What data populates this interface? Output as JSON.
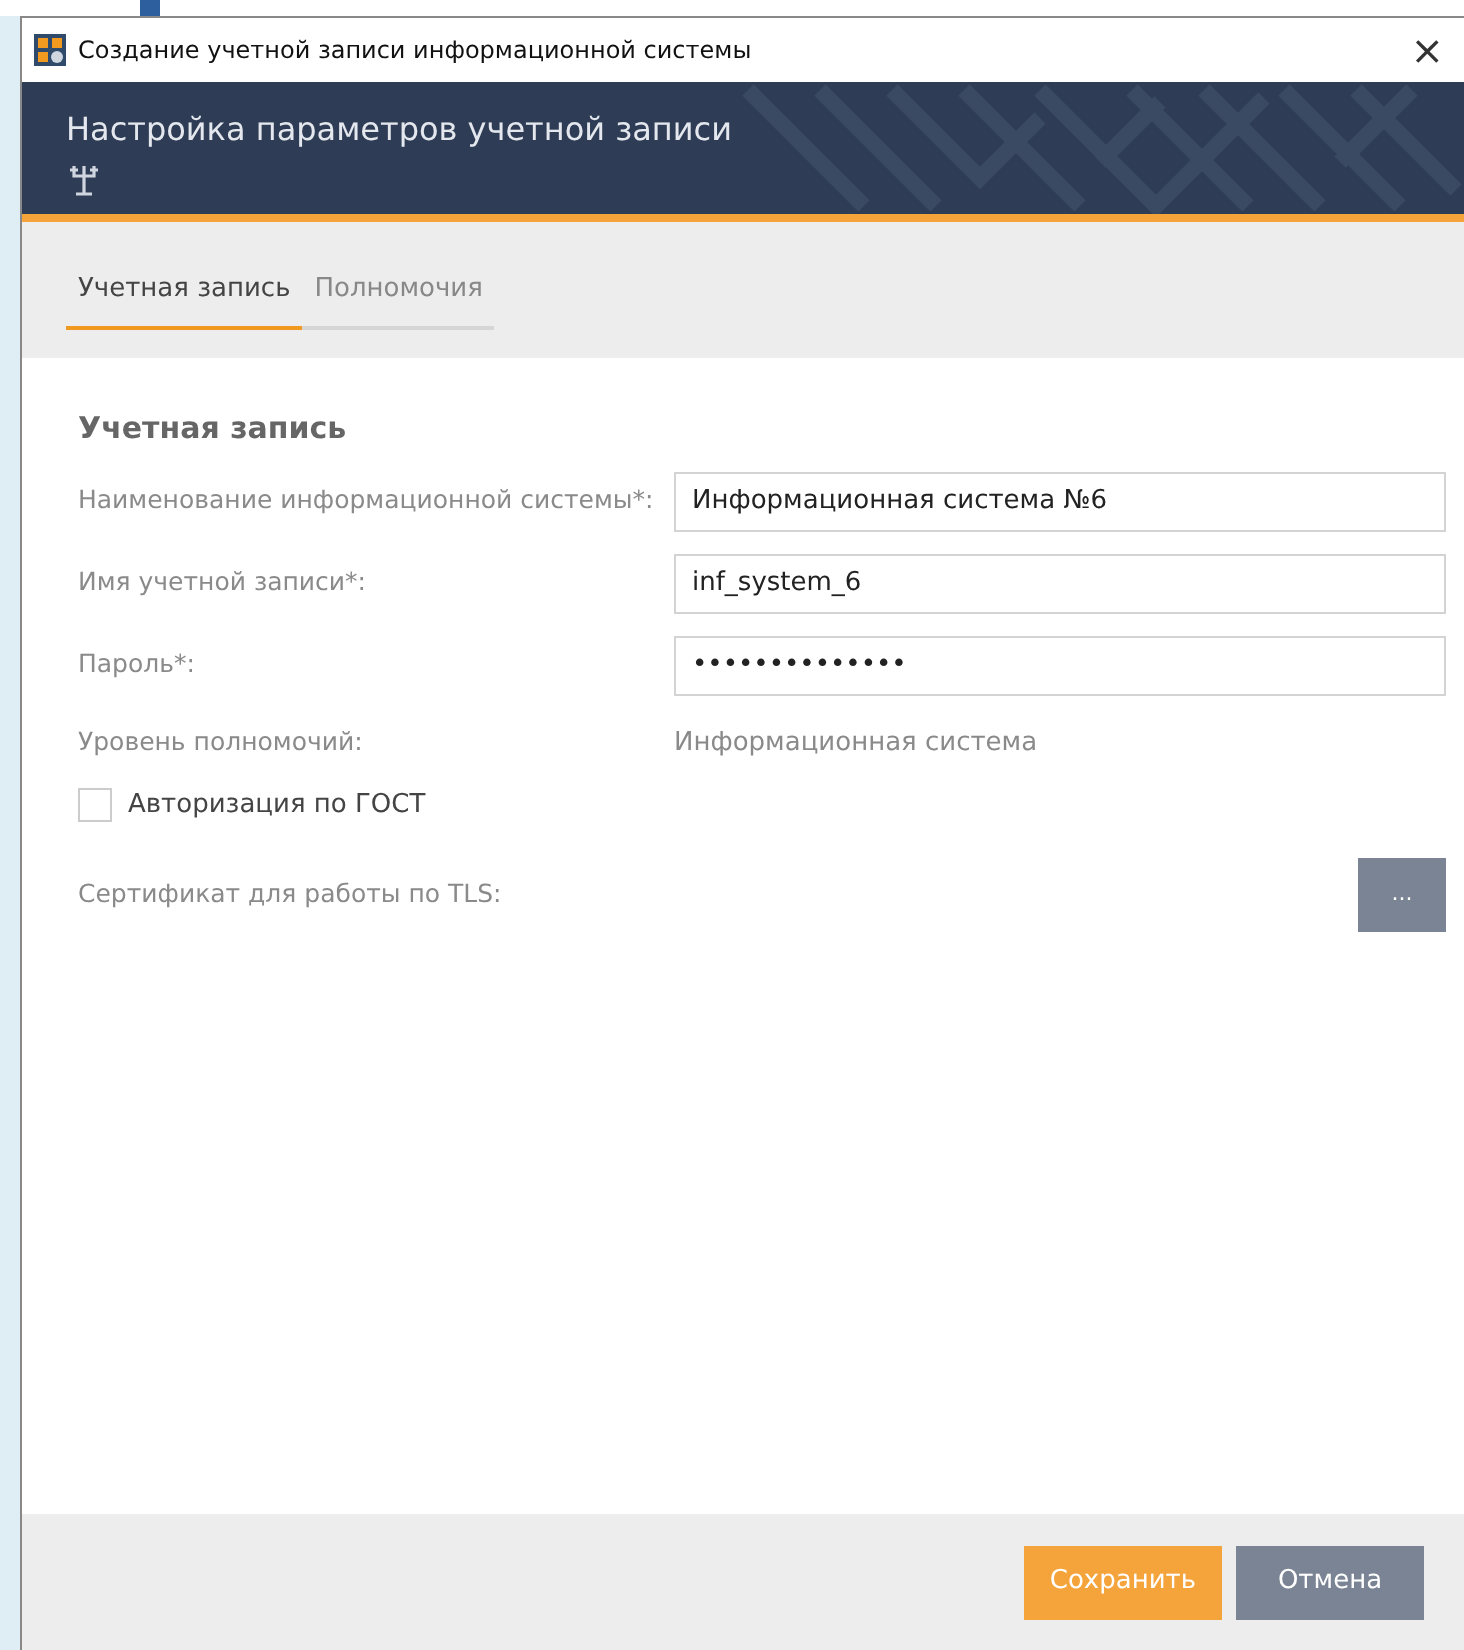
{
  "window": {
    "title": "Создание учетной записи информационной системы",
    "close": "×"
  },
  "header": {
    "title": "Настройка параметров учетной записи"
  },
  "tabs": [
    {
      "label": "Учетная запись",
      "selected": true
    },
    {
      "label": "Полномочия",
      "selected": false
    }
  ],
  "section": {
    "title": "Учетная запись"
  },
  "fields": [
    {
      "kind": "input",
      "label": "Наименование информационной системы*:",
      "value": "Информационная система №6"
    },
    {
      "kind": "input",
      "label": "Имя учетной записи*:",
      "value": "inf_system_6"
    },
    {
      "kind": "input",
      "label": "Пароль*:",
      "value": "••••••••••••••"
    },
    {
      "kind": "text",
      "label": "Уровень полномочий:",
      "value": "Информационная система"
    },
    {
      "kind": "checkbox",
      "label": "Авторизация по ГОСТ",
      "checked": false
    },
    {
      "kind": "browse",
      "label": "Сертификат для работы по TLS:",
      "button": "..."
    }
  ],
  "buttons": [
    {
      "label": "Сохранить",
      "kind": "primary"
    },
    {
      "label": "Отмена",
      "kind": "secondary"
    }
  ]
}
